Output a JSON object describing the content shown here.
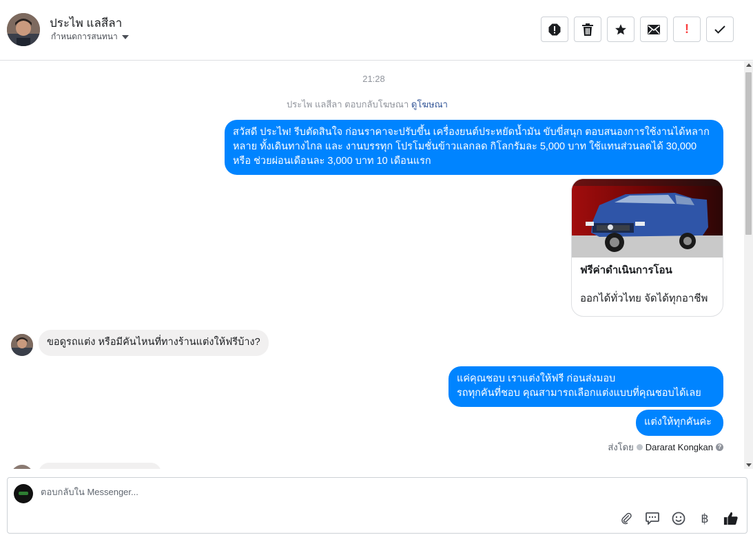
{
  "header": {
    "contact_name": "ประไพ แลสีลา",
    "conversation_setting": "กำหนดการสนทนา",
    "toolbar": [
      {
        "name": "spam-icon"
      },
      {
        "name": "trash-icon"
      },
      {
        "name": "star-icon"
      },
      {
        "name": "envelope-icon"
      },
      {
        "name": "important-icon",
        "label": "!"
      },
      {
        "name": "check-icon"
      }
    ]
  },
  "conversation": {
    "timestamp": "21:28",
    "ad_reply_text": "ประไพ แลสีลา ตอบกลับโฆษณา",
    "ad_reply_link": "ดูโฆษณา",
    "messages": [
      {
        "from": "page",
        "text": "สวัสดี ประไพ!  รีบตัดสินใจ ก่อนราคาจะปรับขึ้น เครื่องยนต์ประหยัดน้ำมัน ขับขี่สนุก ตอบสนองการใช้งานได้หลากหลาย ทั้งเดินทางไกล และ งานบรรทุก โปรโมชั่นข้าวแลกลด กิโลกรัมละ 5,000 บาท ใช้แทนส่วนลดได้ 30,000 หรือ ช่วยผ่อนเดือนละ 3,000 บาท  10 เดือนแรก"
      },
      {
        "from": "page",
        "type": "card",
        "card_title": "ฟรีค่าดำเนินการโอน",
        "card_subtitle": "ออกได้ทั่วไทย จัดได้ทุกอาชีพ"
      },
      {
        "from": "user",
        "text": "ขอดูรถแต่ง หรือมีคันไหนที่ทางร้านแต่งให้ฟรีบ้าง?"
      },
      {
        "from": "page",
        "text_line1": "แค่คุณชอบ เราแต่งให้ฟรี ก่อนส่งมอบ",
        "text_line2": "รถทุกคันที่ชอบ คุณสามารถเลือกแต่งแบบที่คุณชอบได้เลย"
      },
      {
        "from": "page",
        "text": "แต่งให้ทุกคันค่ะ"
      }
    ],
    "sent_by_label": "ส่งโดย",
    "sent_by_name": "Dararat Kongkan"
  },
  "composer": {
    "placeholder": "ตอบกลับใน Messenger...",
    "tools": [
      "paperclip-icon",
      "chat-bubble-icon",
      "emoji-icon",
      "baht-icon",
      "thumbs-up-icon"
    ],
    "baht_symbol": "฿"
  },
  "colors": {
    "outgoing_bubble": "#0084ff",
    "incoming_bubble": "#f1f0f0",
    "link": "#365899",
    "important": "#fa3e3e"
  }
}
